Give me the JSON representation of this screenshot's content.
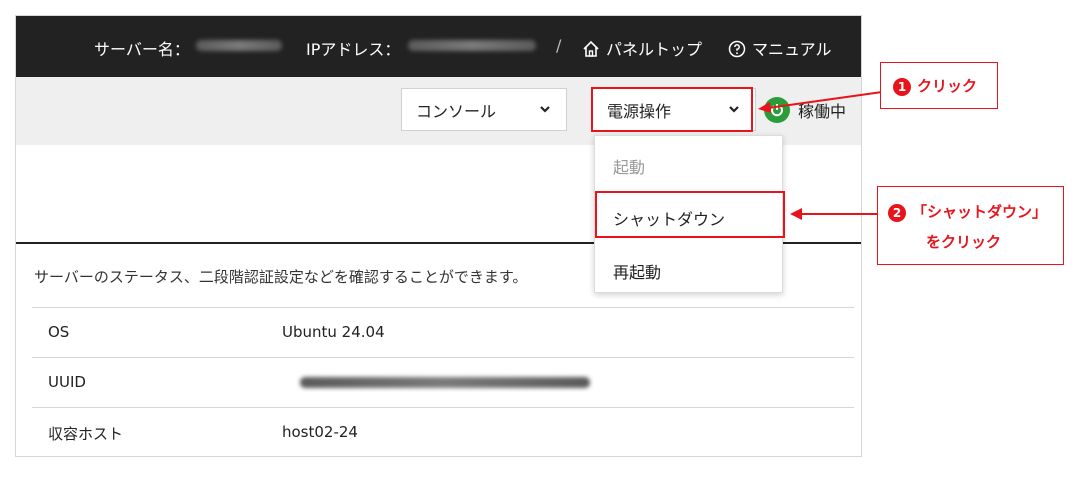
{
  "header": {
    "server_label": "サーバー名：",
    "ip_label": "IPアドレス：",
    "separator": "/",
    "panel_top": "パネルトップ",
    "manual": "マニュアル"
  },
  "toolbar": {
    "console_select": "コンソール",
    "power_select": "電源操作",
    "status": "稼働中"
  },
  "power_menu": {
    "items": [
      "起動",
      "シャットダウン",
      "再起動"
    ]
  },
  "description": "サーバーのステータス、二段階認証設定などを確認することができます。",
  "info_rows": [
    {
      "key": "OS",
      "value": "Ubuntu 24.04"
    },
    {
      "key": "UUID",
      "value": ""
    },
    {
      "key": "収容ホスト",
      "value": "host02-24"
    }
  ],
  "callouts": {
    "one_num": "1",
    "one_text": "クリック",
    "two_num": "2",
    "two_line1": "「シャットダウン」",
    "two_line2": "をクリック"
  },
  "colors": {
    "accent_red": "#e8141c",
    "header_bg": "#222222",
    "status_green": "#2a9d3a"
  }
}
